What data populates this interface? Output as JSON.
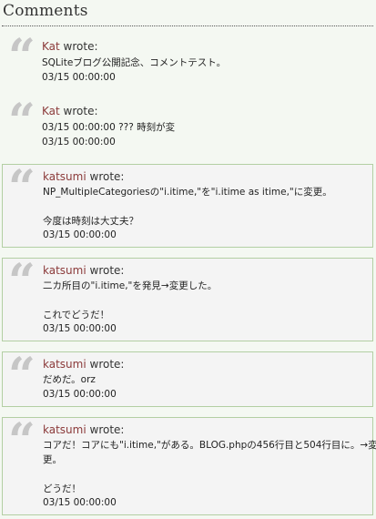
{
  "heading": "Comments",
  "comments": [
    {
      "author": "Kat",
      "verb": "wrote:",
      "lines": [
        "SQLiteブログ公開記念、コメントテスト。"
      ],
      "time": "03/15 00:00:00"
    },
    {
      "author": "Kat",
      "verb": "wrote:",
      "lines": [
        "03/15 00:00:00 ??? 時刻が変"
      ],
      "time": "03/15 00:00:00"
    },
    {
      "author": "katsumi",
      "verb": "wrote:",
      "lines": [
        "NP_MultipleCategoriesの\"i.itime,\"を\"i.itime as itime,\"に変更。",
        "",
        "今度は時刻は大丈夫？"
      ],
      "time": "03/15 00:00:00"
    },
    {
      "author": "katsumi",
      "verb": "wrote:",
      "lines": [
        "二カ所目の\"i.itime,\"を発見→変更した。",
        "",
        "これでどうだ！"
      ],
      "time": "03/15 00:00:00"
    },
    {
      "author": "katsumi",
      "verb": "wrote:",
      "lines": [
        "だめだ。orz"
      ],
      "time": "03/15 00:00:00"
    },
    {
      "author": "katsumi",
      "verb": "wrote:",
      "lines": [
        "コアだ！コアにも\"i.itime,\"がある。BLOG.phpの456行目と504行目に。→変",
        "更。",
        "",
        "どうだ！"
      ],
      "time": "03/15 00:00:00"
    }
  ]
}
